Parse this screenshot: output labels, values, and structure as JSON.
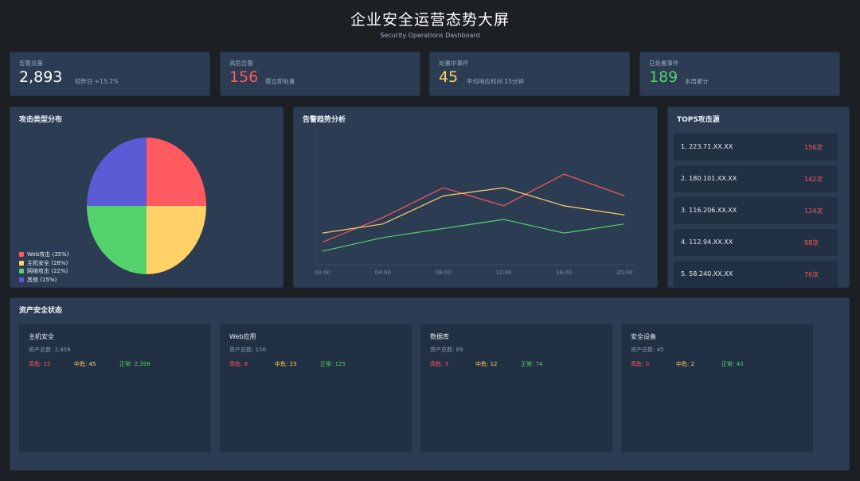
{
  "header": {
    "title": "企业安全运营态势大屏",
    "subtitle": "Security Operations Dashboard"
  },
  "kpis": [
    {
      "label": "告警总量",
      "value": "2,893",
      "note": "较昨日 +15.2%",
      "color": "#ffffff"
    },
    {
      "label": "高危告警",
      "value": "156",
      "note": "需立即处置",
      "color": "#ff5a5f"
    },
    {
      "label": "处置中事件",
      "value": "45",
      "note": "平均响应时间 15分钟",
      "color": "#ffd166"
    },
    {
      "label": "已处置事件",
      "value": "189",
      "note": "本周累计",
      "color": "#53d36b"
    }
  ],
  "attack_types": {
    "title": "攻击类型分布",
    "chart_data": {
      "type": "pie",
      "categories": [
        "Web攻击",
        "主机安全",
        "网络攻击",
        "其他"
      ],
      "values": [
        35,
        28,
        22,
        15
      ],
      "legend": [
        "Web攻击 (35%)",
        "主机安全 (28%)",
        "网络攻击 (22%)",
        "其他 (15%)"
      ],
      "colors": [
        "#ff5a5f",
        "#ffd166",
        "#53d36b",
        "#5b5bd6"
      ],
      "legend_position": "bottom-left"
    }
  },
  "trend": {
    "title": "告警趋势分析",
    "chart_data": {
      "type": "line",
      "x": [
        "00:00",
        "04:00",
        "08:00",
        "12:00",
        "16:00",
        "20:00"
      ],
      "series": [
        {
          "values": [
            25,
            52,
            85,
            65,
            100,
            76
          ],
          "color": "#ff5a5f"
        },
        {
          "values": [
            35,
            45,
            76,
            85,
            65,
            55
          ],
          "color": "#ffd166"
        },
        {
          "values": [
            15,
            30,
            40,
            50,
            35,
            45
          ],
          "color": "#53d36b"
        }
      ],
      "ylim": [
        0,
        150
      ],
      "grid": false
    }
  },
  "top5": {
    "title": "TOP5攻击源",
    "items": [
      {
        "ip": "1. 223.71.XX.XX",
        "count": "156次"
      },
      {
        "ip": "2. 180.101.XX.XX",
        "count": "142次"
      },
      {
        "ip": "3. 116.206.XX.XX",
        "count": "124次"
      },
      {
        "ip": "4. 112.94.XX.XX",
        "count": "98次"
      },
      {
        "ip": "5. 58.240.XX.XX",
        "count": "76次"
      }
    ]
  },
  "assets": {
    "title": "资产安全状态",
    "cards": [
      {
        "name": "主机安全",
        "total": "资产总数: 2,459",
        "high": "高危: 15",
        "mid": "中危: 45",
        "normal": "正常: 2,399"
      },
      {
        "name": "Web应用",
        "total": "资产总数: 156",
        "high": "高危: 8",
        "mid": "中危: 23",
        "normal": "正常: 125"
      },
      {
        "name": "数据库",
        "total": "资产总数: 89",
        "high": "高危: 3",
        "mid": "中危: 12",
        "normal": "正常: 74"
      },
      {
        "name": "安全设备",
        "total": "资产总数: 45",
        "high": "高危: 0",
        "mid": "中危: 2",
        "normal": "正常: 43"
      }
    ]
  }
}
